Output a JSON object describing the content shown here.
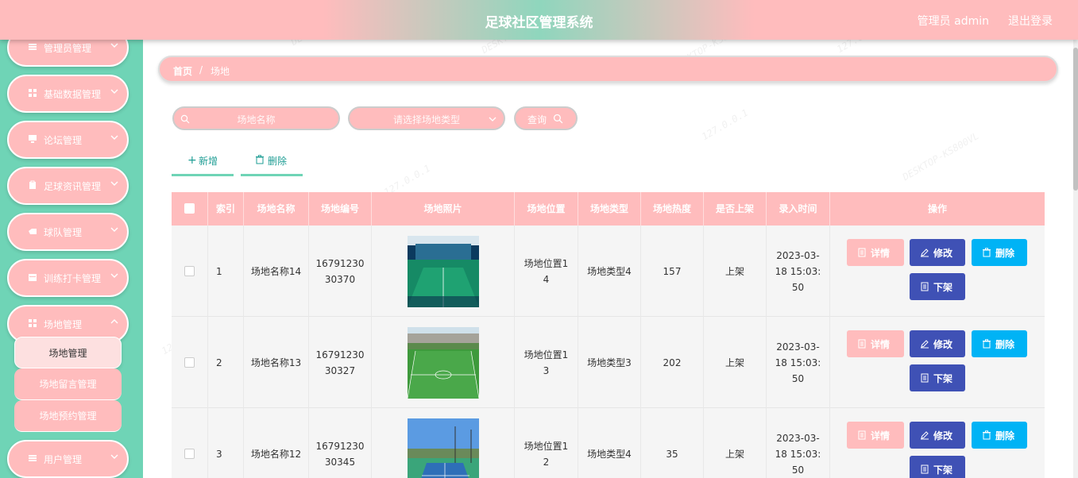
{
  "header": {
    "title": "足球社区管理系统",
    "user": "管理员 admin",
    "logout": "退出登录"
  },
  "sidebar": {
    "items": [
      {
        "label": "管理员管理",
        "icon": "list-icon"
      },
      {
        "label": "基础数据管理",
        "icon": "grid-icon"
      },
      {
        "label": "论坛管理",
        "icon": "monitor-icon"
      },
      {
        "label": "足球资讯管理",
        "icon": "clipboard-icon"
      },
      {
        "label": "球队管理",
        "icon": "hand-icon"
      },
      {
        "label": "训练打卡管理",
        "icon": "calendar-icon"
      },
      {
        "label": "场地管理",
        "icon": "grid-icon"
      },
      {
        "label": "用户管理",
        "icon": "list-icon"
      }
    ],
    "submenu": [
      {
        "label": "场地管理",
        "active": true
      },
      {
        "label": "场地留言管理",
        "active": false
      },
      {
        "label": "场地预约管理",
        "active": false
      }
    ]
  },
  "breadcrumb": {
    "home": "首页",
    "separator": "/",
    "current": "场地"
  },
  "search": {
    "name_placeholder": "场地名称",
    "type_placeholder": "请选择场地类型",
    "query_label": "查询"
  },
  "actions": {
    "add_label": "新增",
    "delete_label": "删除"
  },
  "table": {
    "headers": [
      "索引",
      "场地名称",
      "场地编号",
      "场地照片",
      "场地位置",
      "场地类型",
      "场地热度",
      "是否上架",
      "录入时间",
      "操作"
    ],
    "rows": [
      {
        "index": "1",
        "name": "场地名称14",
        "code": "1679123030370",
        "photo": "indoor-court",
        "location": "场地位置14",
        "type": "场地类型4",
        "heat": "157",
        "status": "上架",
        "time": "2023-03-18 15:03:50"
      },
      {
        "index": "2",
        "name": "场地名称13",
        "code": "1679123030327",
        "photo": "football-field",
        "location": "场地位置13",
        "type": "场地类型3",
        "heat": "202",
        "status": "上架",
        "time": "2023-03-18 15:03:50"
      },
      {
        "index": "3",
        "name": "场地名称12",
        "code": "1679123030345",
        "photo": "tennis-court",
        "location": "场地位置12",
        "type": "场地类型4",
        "heat": "35",
        "status": "上架",
        "time": "2023-03-18 15:03:50"
      }
    ],
    "op_labels": {
      "detail": "详情",
      "edit": "修改",
      "delete": "删除",
      "off": "下架"
    }
  },
  "watermark": [
    "127.0.0.1",
    "DESKTOP-KS800VL"
  ],
  "colors": {
    "accent_pink": "#ffbcbd",
    "sidebar_green": "#6fd4b6",
    "edit_blue": "#3f51b5",
    "delete_cyan": "#00b3f5"
  }
}
